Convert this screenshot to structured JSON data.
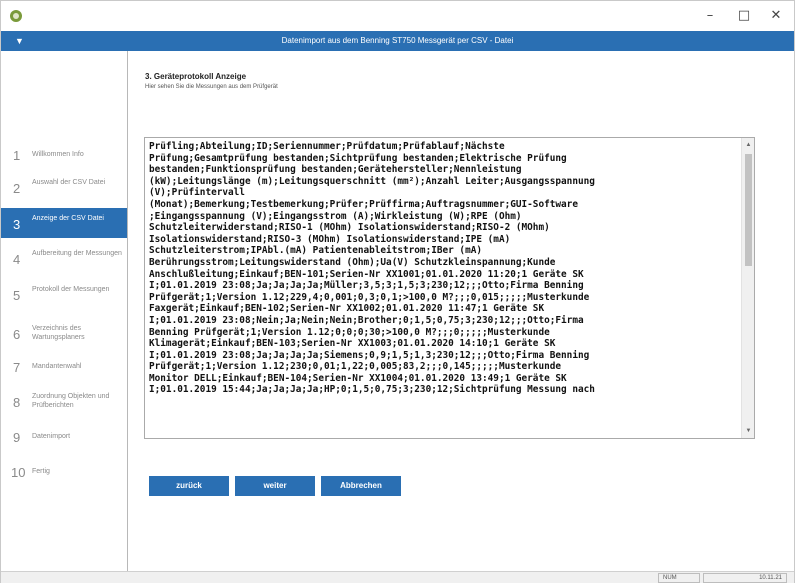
{
  "window": {
    "title": "Datenimport aus dem Benning ST750 Messgerät per CSV - Datei",
    "minimize_label": "–",
    "maximize_label": "□",
    "close_label": "✕",
    "accent_color": "#2a6fb3"
  },
  "sidebar": {
    "items": [
      {
        "num": "1",
        "label": "Willkommen Info"
      },
      {
        "num": "2",
        "label": "Auswahl der CSV Datei"
      },
      {
        "num": "3",
        "label": "Anzeige der CSV Datei"
      },
      {
        "num": "4",
        "label": "Aufbereitung der Messungen"
      },
      {
        "num": "5",
        "label": "Protokoll der Messungen"
      },
      {
        "num": "6",
        "label": "Verzeichnis des Wartungsplaners"
      },
      {
        "num": "7",
        "label": "Mandantenwahl"
      },
      {
        "num": "8",
        "label": "Zuordnung Objekten und Prüfberichten"
      },
      {
        "num": "9",
        "label": "Datenimport"
      },
      {
        "num": "10",
        "label": "Fertig"
      }
    ],
    "active_index": 2
  },
  "main": {
    "title": "3. Geräteprotokoll Anzeige",
    "subtitle": "Hier sehen Sie die Messungen aus dem Prüfgerät",
    "csv_lines": [
      "Prüfling;Abteilung;ID;Seriennummer;Prüfdatum;Prüfablauf;Nächste",
      "Prüfung;Gesamtprüfung bestanden;Sichtprüfung bestanden;Elektrische Prüfung",
      "bestanden;Funktionsprüfung bestanden;Gerätehersteller;Nennleistung",
      "(kW);Leitungslänge (m);Leitungsquerschnitt (mm²);Anzahl Leiter;Ausgangsspannung",
      "(V);Prüfintervall",
      "(Monat);Bemerkung;Testbemerkung;Prüfer;Prüffirma;Auftragsnummer;GUI-Software",
      ";Eingangsspannung (V);Eingangsstrom (A);Wirkleistung (W);RPE (Ohm)",
      "Schutzleiterwiderstand;RISO-1 (MOhm) Isolationswiderstand;RISO-2 (MOhm)",
      "Isolationswiderstand;RISO-3 (MOhm) Isolationswiderstand;IPE (mA)",
      "Schutzleiterstrom;IPAbl.(mA) Patientenableitstrom;IBer (mA)",
      "Berührungsstrom;Leitungswiderstand (Ohm);Ua(V) Schutzkleinspannung;Kunde",
      "Anschlußleitung;Einkauf;BEN-101;Serien-Nr XX1001;01.01.2020 11:20;1 Geräte SK",
      "I;01.01.2019 23:08;Ja;Ja;Ja;Ja;Müller;3,5;3;1,5;3;230;12;;;Otto;Firma Benning",
      "Prüfgerät;1;Version 1.12;229,4;0,001;0,3;0,1;>100,0 M?;;;0,015;;;;;Musterkunde",
      "Faxgerät;Einkauf;BEN-102;Serien-Nr XX1002;01.01.2020 11:47;1 Geräte SK",
      "I;01.01.2019 23:08;Nein;Ja;Nein;Nein;Brother;0;1,5;0,75;3;230;12;;;Otto;Firma",
      "Benning Prüfgerät;1;Version 1.12;0;0;0;30;>100,0 M?;;;0;;;;;Musterkunde",
      "Klimagerät;Einkauf;BEN-103;Serien-Nr XX1003;01.01.2020 14:10;1 Geräte SK",
      "I;01.01.2019 23:08;Ja;Ja;Ja;Ja;Siemens;0,9;1,5;1,3;230;12;;;Otto;Firma Benning",
      "Prüfgerät;1;Version 1.12;230;0,01;1,22;0,005;83,2;;;0,145;;;;;Musterkunde",
      "Monitor DELL;Einkauf;BEN-104;Serien-Nr XX1004;01.01.2020 13:49;1 Geräte SK",
      "I;01.01.2019 15:44;Ja;Ja;Ja;Ja;HP;0;1,5;0,75;3;230;12;Sichtprüfung Messung nach"
    ]
  },
  "buttons": {
    "back_label": "zurück",
    "next_label": "weiter",
    "cancel_label": "Abbrechen"
  },
  "statusbar": {
    "num_label": "NUM",
    "date_label": "10.11.21"
  }
}
